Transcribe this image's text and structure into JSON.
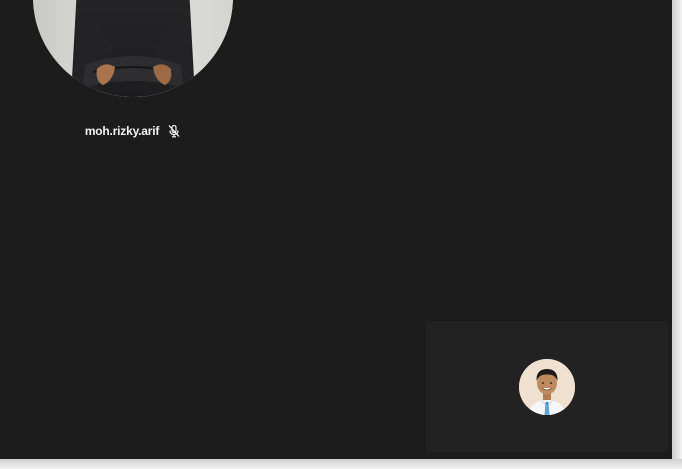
{
  "main_participant": {
    "name": "moh.rizky.arif",
    "mic_state_icon": "mic-muted-icon"
  },
  "self_view": {
    "avatar_icon": "user-avatar"
  },
  "colors": {
    "background": "#1c1c1c",
    "self_view_background": "#222222",
    "name_text": "#f2f2f2"
  }
}
